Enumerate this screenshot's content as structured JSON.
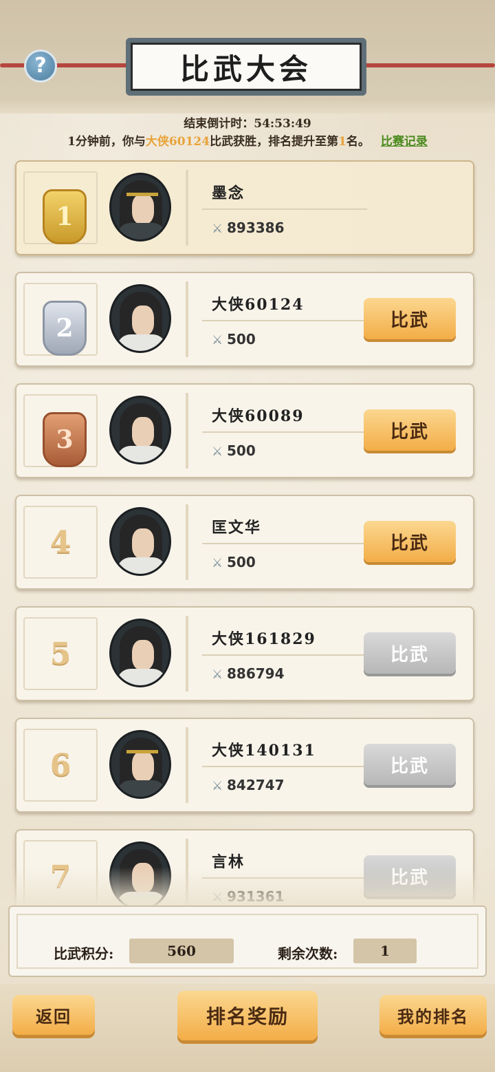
{
  "header": {
    "title": "比武大会",
    "help_symbol": "?",
    "countdown": "结束倒计时：54:53:49",
    "message_prefix": "1分钟前，你与",
    "message_opponent": "大侠60124",
    "message_middle": "比武获胜，排名提升至第",
    "message_rank": "1",
    "message_suffix": "名。",
    "record_link": "比赛记录"
  },
  "rows": [
    {
      "rank": "1",
      "name": "墨念",
      "score": "893386",
      "button": "",
      "button_enabled": false
    },
    {
      "rank": "2",
      "name": "大侠60124",
      "score": "500",
      "button": "比武",
      "button_enabled": true
    },
    {
      "rank": "3",
      "name": "大侠60089",
      "score": "500",
      "button": "比武",
      "button_enabled": true
    },
    {
      "rank": "4",
      "name": "匡文华",
      "score": "500",
      "button": "比武",
      "button_enabled": true
    },
    {
      "rank": "5",
      "name": "大侠161829",
      "score": "886794",
      "button": "比武",
      "button_enabled": false
    },
    {
      "rank": "6",
      "name": "大侠140131",
      "score": "842747",
      "button": "比武",
      "button_enabled": false
    },
    {
      "rank": "7",
      "name": "言林",
      "score": "931361",
      "button": "比武",
      "button_enabled": false
    }
  ],
  "stats": {
    "points_label": "比武积分:",
    "points_value": "560",
    "remaining_label": "剩余次数:",
    "remaining_value": "1"
  },
  "footer": {
    "back": "返回",
    "rewards": "排名奖励",
    "my_rank": "我的排名"
  },
  "colors": {
    "accent_orange": "#f3ad47",
    "highlight": "#e8a33b",
    "link_green": "#4b8a1e",
    "disabled_gray": "#b7b7b7"
  }
}
